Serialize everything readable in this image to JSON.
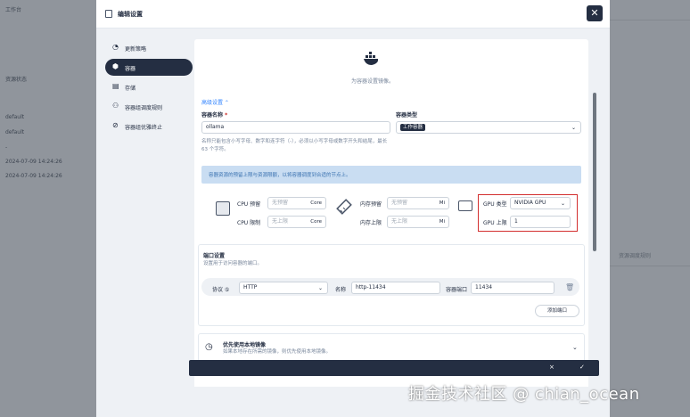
{
  "background": {
    "left_texts": [
      "工作台",
      "资源状态",
      "default",
      "default",
      "-",
      "2024-07-09 14:24:26",
      "2024-07-09 14:24:26"
    ],
    "right_text": "资源调度规则"
  },
  "modal": {
    "title": "编辑设置",
    "close_icon": "close-icon"
  },
  "nav": {
    "items": [
      {
        "label": "更新策略",
        "icon": "update-icon",
        "active": false
      },
      {
        "label": "容器",
        "icon": "container-icon",
        "active": true
      },
      {
        "label": "存储",
        "icon": "storage-icon",
        "active": false
      },
      {
        "label": "容器组调度规则",
        "icon": "schedule-icon",
        "active": false
      },
      {
        "label": "容器组优雅终止",
        "icon": "terminate-icon",
        "active": false
      }
    ]
  },
  "image_section": {
    "hint": "为容器设置镜像。",
    "advanced_toggle": "高级设置 ⌃"
  },
  "container_form": {
    "name_label": "容器名称",
    "name_required": "*",
    "name_value": "ollama",
    "name_desc": "名称只能包含小写字母、数字和连字符（-），必须以小写字母或数字开头和结尾，最长 63 个字符。",
    "type_label": "容器类型",
    "type_value": "工作容器"
  },
  "resource": {
    "info": "容器资源的预留上限与资源限额，以将容器调度到合适的节点上。",
    "cpu_reserve_label": "CPU 预留",
    "cpu_reserve_placeholder": "无预留",
    "cpu_limit_label": "CPU 限制",
    "cpu_limit_placeholder": "无上限",
    "cpu_unit": "Core",
    "mem_reserve_label": "内存预留",
    "mem_reserve_placeholder": "无预留",
    "mem_limit_label": "内存上限",
    "mem_limit_placeholder": "无上限",
    "mem_unit": "Mi",
    "gpu_type_label": "GPU 类型",
    "gpu_type_value": "NVIDIA GPU",
    "gpu_limit_label": "GPU 上限",
    "gpu_limit_value": "1"
  },
  "ports": {
    "title": "端口设置",
    "desc": "设置用于访问容器的端口。",
    "protocol_label": "协议 ⑤",
    "protocol_value": "HTTP",
    "name_label": "名称",
    "name_value": "http-11434",
    "container_port_label": "容器端口",
    "container_port_value": "11434",
    "add_label": "添加端口"
  },
  "local_image": {
    "title": "优先使用本地镜像",
    "desc": "如果本地存在所需的镜像，则优先使用本地镜像。"
  },
  "footer": {
    "cancel_icon": "×",
    "confirm_icon": "✓"
  },
  "watermark": "掘金技术社区 @ chian_ocean"
}
